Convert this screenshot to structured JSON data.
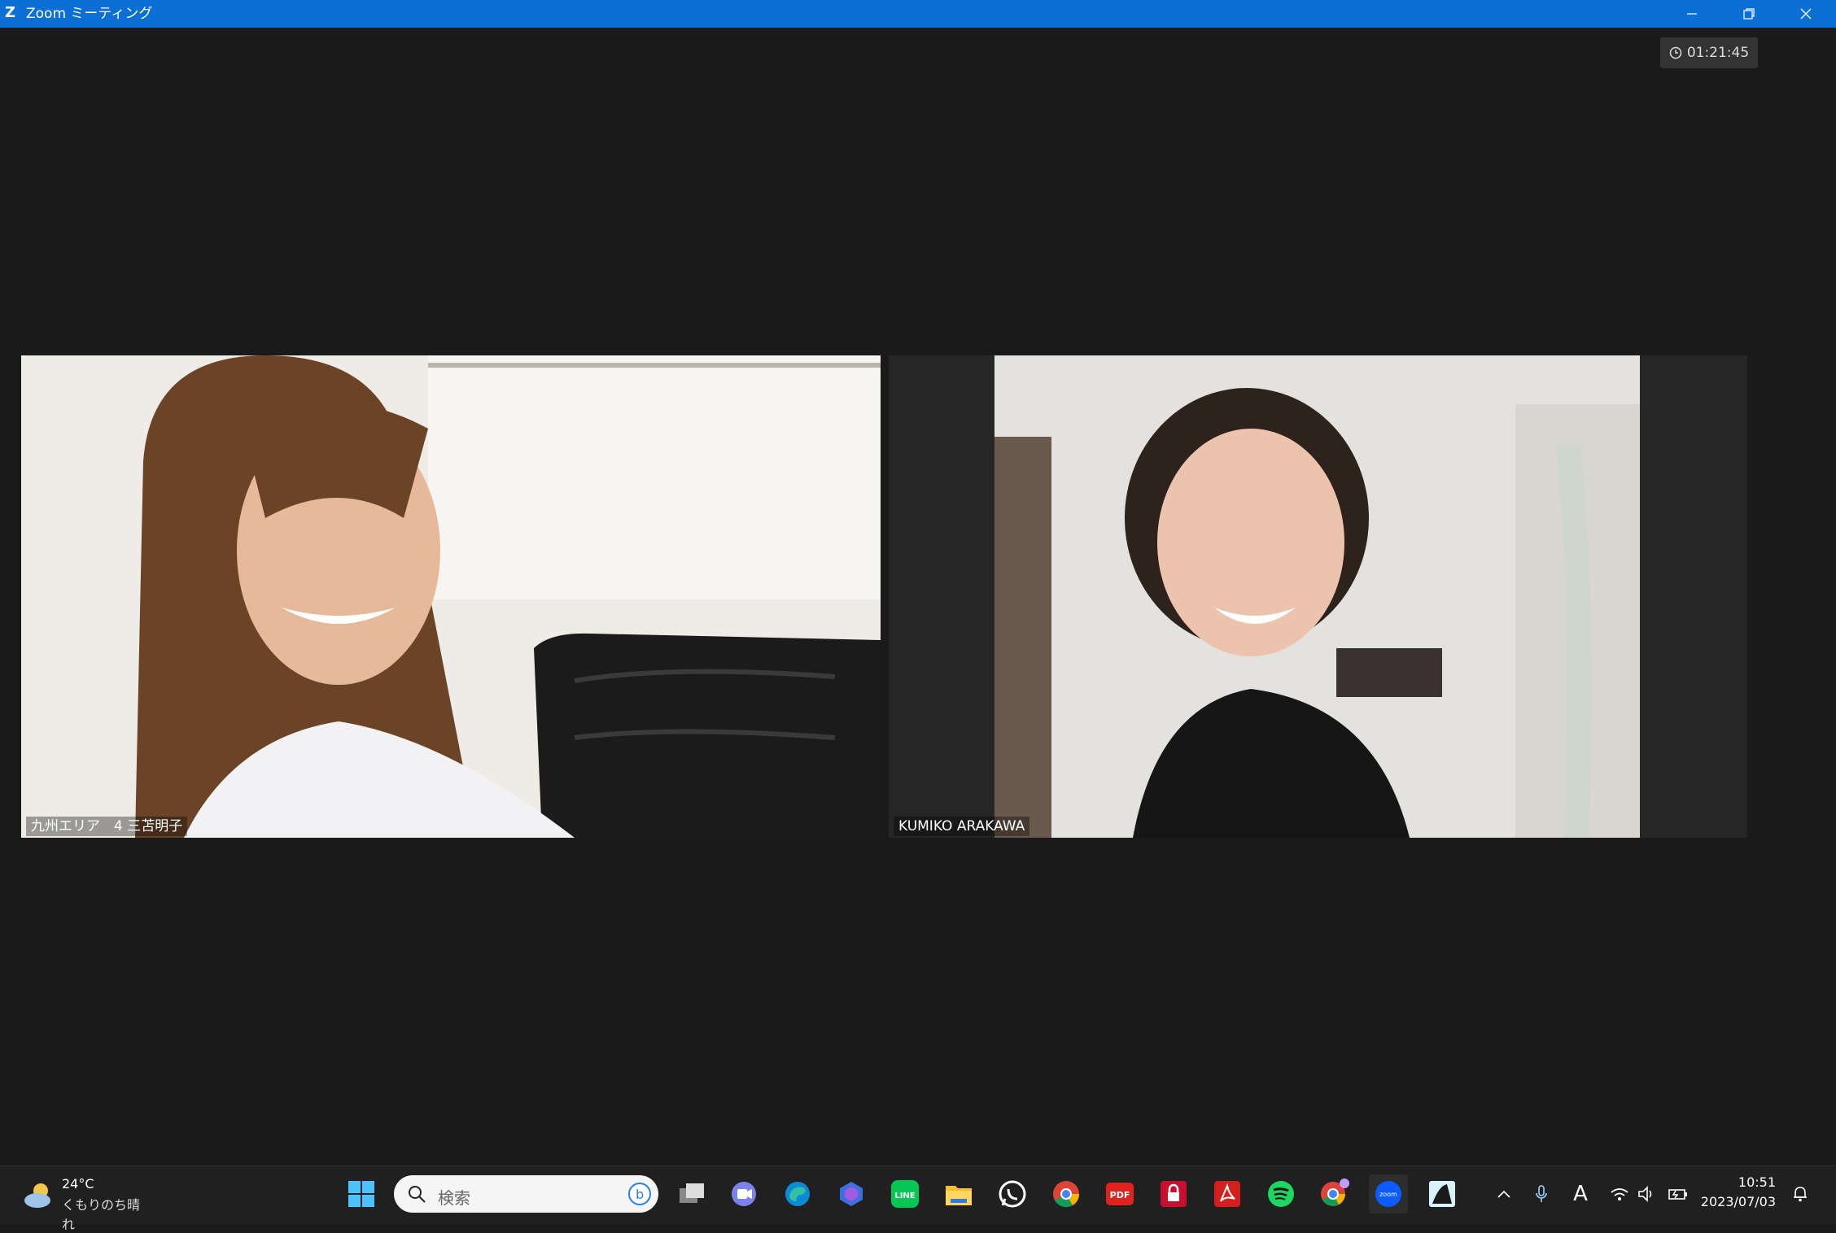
{
  "window": {
    "title": "Zoom ミーティング",
    "logo": "Z"
  },
  "meeting": {
    "elapsed": "01:21:45"
  },
  "participants": [
    {
      "name": "九州エリア　4 三苫明子"
    },
    {
      "name": "KUMIKO ARAKAWA"
    }
  ],
  "taskbar": {
    "weather": {
      "temp": "24°C",
      "condition": "くもりのち晴れ"
    },
    "search_placeholder": "検索",
    "clock": {
      "time": "10:51",
      "date": "2023/07/03"
    },
    "ime": "A",
    "pdf_label": "PDF",
    "zoom_label": "zoom",
    "line_label": "LINE"
  },
  "colors": {
    "titlebar": "#0b6fd6",
    "background": "#1a1a1a",
    "taskbar": "#202020"
  }
}
